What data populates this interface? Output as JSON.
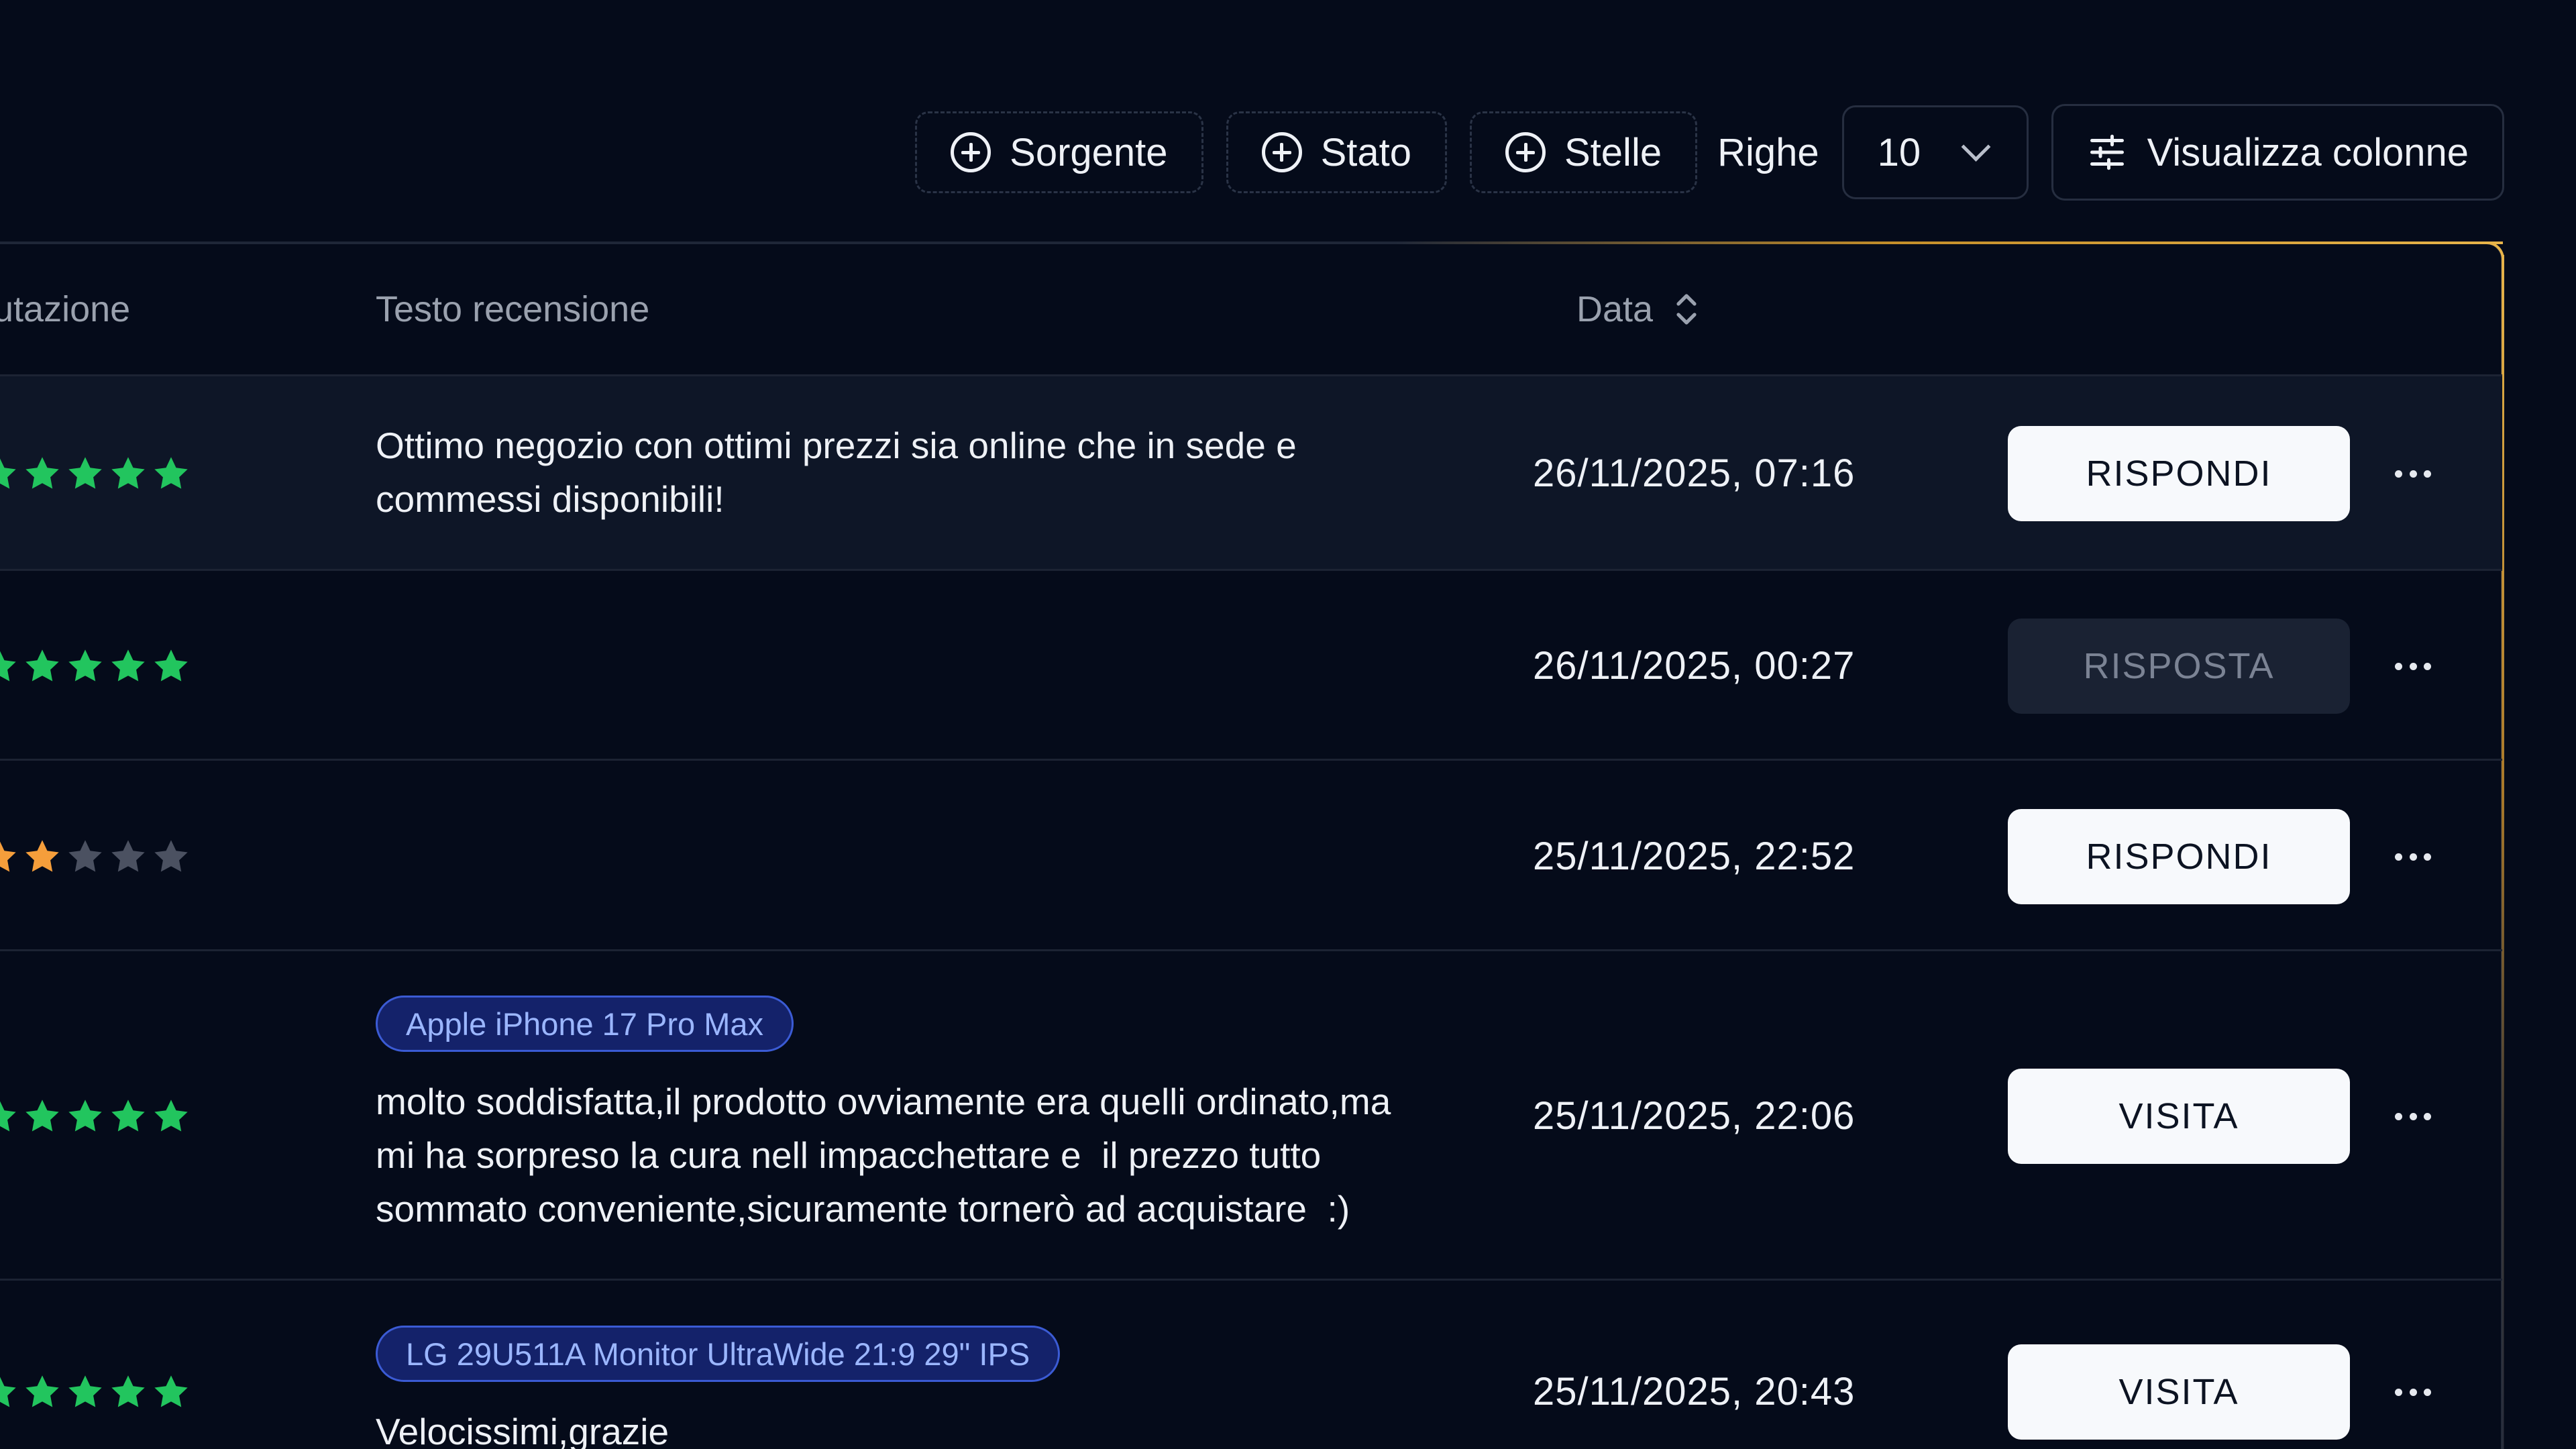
{
  "toolbar": {
    "filters": [
      {
        "label": "Sorgente",
        "icon": "plus-circle-icon"
      },
      {
        "label": "Stato",
        "icon": "plus-circle-icon"
      },
      {
        "label": "Stelle",
        "icon": "plus-circle-icon"
      }
    ],
    "rows_label": "Righe",
    "rows_value": "10",
    "columns_label": "Visualizza colonne"
  },
  "table": {
    "headers": {
      "rating": "utazione",
      "text": "Testo recensione",
      "date": "Data"
    },
    "rows": [
      {
        "stars_filled": 5,
        "star_color": "#22c55e",
        "tag": "",
        "text_lines": [
          "Ottimo negozio con ottimi prezzi sia online che in sede e",
          "commessi disponibili!"
        ],
        "date": "26/11/2025, 07:16",
        "action": "RISPONDI",
        "action_disabled": false
      },
      {
        "stars_filled": 5,
        "star_color": "#22c55e",
        "tag": "",
        "text_lines": [],
        "date": "26/11/2025, 00:27",
        "action": "RISPOSTA",
        "action_disabled": true
      },
      {
        "stars_filled": 2,
        "star_color": "#f59e3b",
        "tag": "",
        "text_lines": [],
        "date": "25/11/2025, 22:52",
        "action": "RISPONDI",
        "action_disabled": false
      },
      {
        "stars_filled": 5,
        "star_color": "#22c55e",
        "tag": "Apple iPhone 17 Pro Max",
        "text_lines": [
          "molto soddisfatta,il prodotto ovviamente era quelli ordinato,ma",
          "mi ha sorpreso la cura nell impacchettare e  il prezzo tutto",
          "sommato conveniente,sicuramente tornerò ad acquistare  :)"
        ],
        "date": "25/11/2025, 22:06",
        "action": "VISITA",
        "action_disabled": false
      },
      {
        "stars_filled": 5,
        "star_color": "#22c55e",
        "tag": "LG 29U511A Monitor UltraWide 21:9 29\" IPS",
        "text_lines": [
          "Velocissimi,grazie"
        ],
        "date": "25/11/2025, 20:43",
        "action": "VISITA",
        "action_disabled": false
      }
    ]
  },
  "colors": {
    "background": "#050b1a",
    "accent_border": "#e8b44a",
    "star_empty": "#4b5161",
    "tag_bg": "#14226a",
    "tag_text": "#9bb6ff"
  }
}
